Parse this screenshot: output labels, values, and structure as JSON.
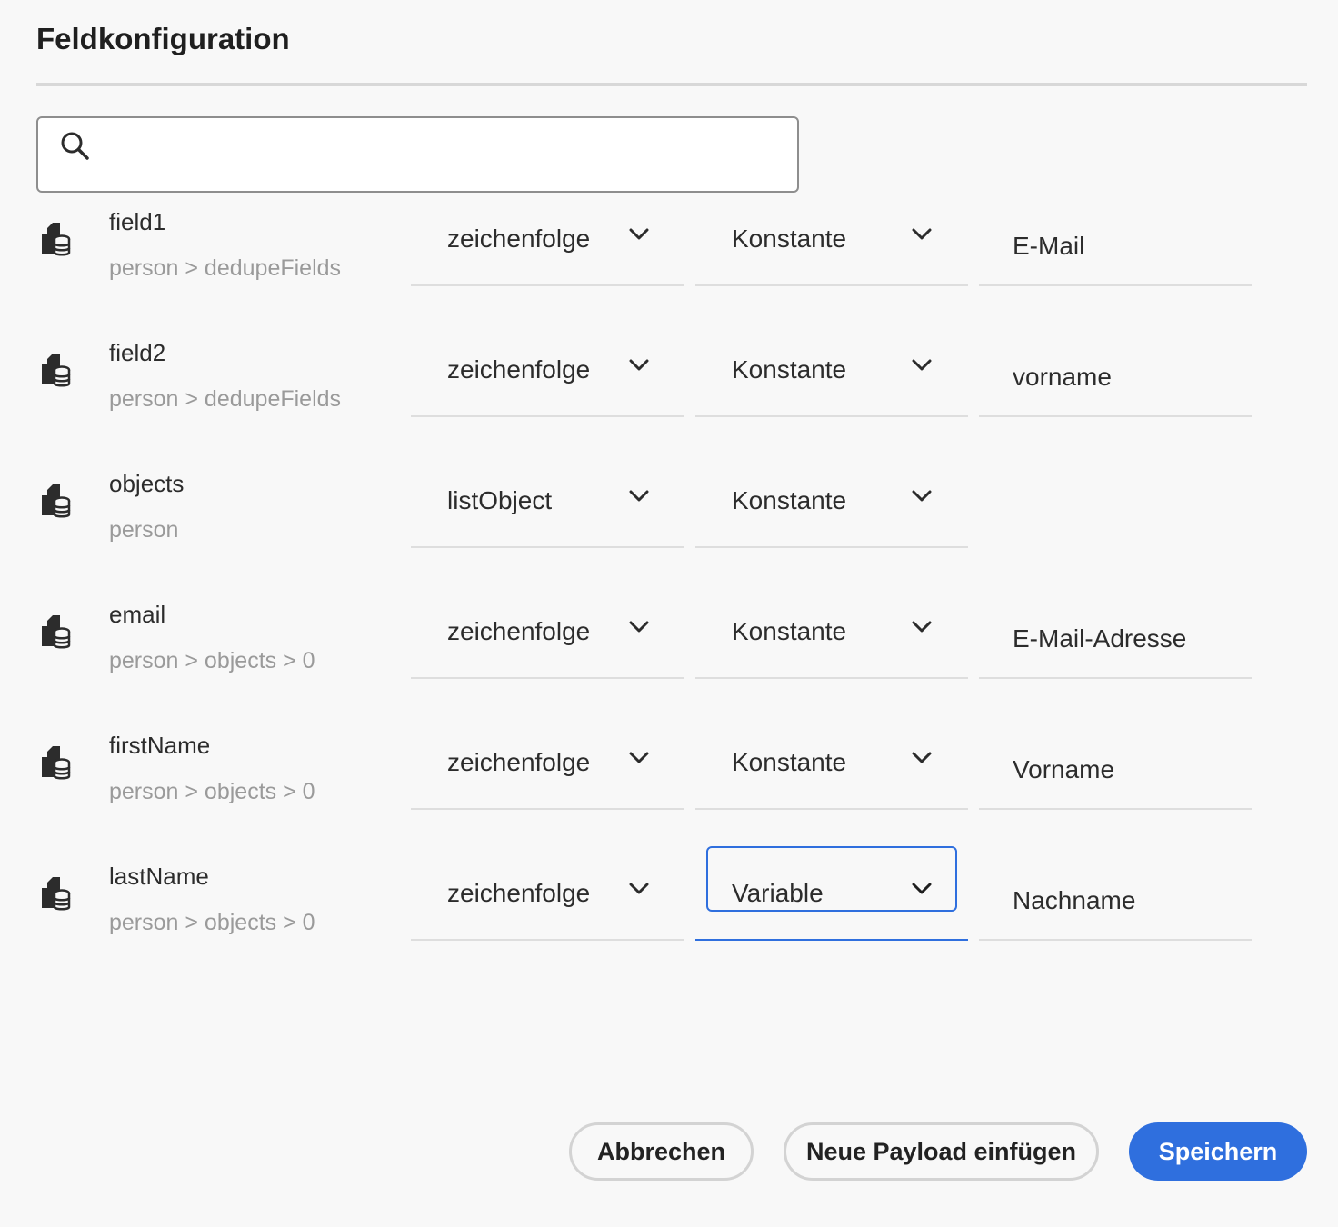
{
  "dialog": {
    "title": "Feldkonfiguration"
  },
  "search": {
    "value": "",
    "placeholder": ""
  },
  "rows": [
    {
      "name": "field1",
      "path": "person > dedupeFields",
      "type": "zeichenfolge",
      "mode": "Konstante",
      "value": "E-Mail"
    },
    {
      "name": "field2",
      "path": "person > dedupeFields",
      "type": "zeichenfolge",
      "mode": "Konstante",
      "value": "vorname"
    },
    {
      "name": "objects",
      "path": "person",
      "type": "listObject",
      "mode": "Konstante",
      "value": ""
    },
    {
      "name": "email",
      "path": "person > objects > 0",
      "type": "zeichenfolge",
      "mode": "Konstante",
      "value": "E-Mail-Adresse"
    },
    {
      "name": "firstName",
      "path": "person > objects > 0",
      "type": "zeichenfolge",
      "mode": "Konstante",
      "value": "Vorname"
    },
    {
      "name": "lastName",
      "path": "person > objects > 0",
      "type": "zeichenfolge",
      "mode": "Variable",
      "value": "Nachname"
    }
  ],
  "footer": {
    "cancel_label": "Abbrechen",
    "insert_label": "Neue Payload einfügen",
    "save_label": "Speichern"
  },
  "colors": {
    "accent": "#2f6fde",
    "muted_text": "#9a9a9a",
    "divider": "#d8d8d8"
  },
  "icons": {
    "search": "search-icon",
    "field": "field-data-icon",
    "dropdown": "chevron-down-icon"
  }
}
